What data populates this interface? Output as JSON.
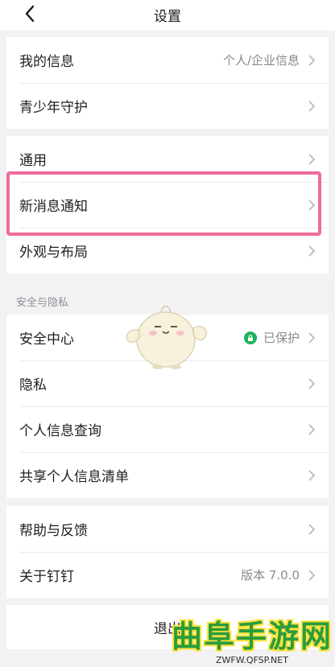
{
  "header": {
    "title": "设置",
    "back_icon": "chevron-left-icon"
  },
  "groups": [
    {
      "rows": [
        {
          "label": "我的信息",
          "value": "个人/企业信息"
        },
        {
          "label": "青少年守护",
          "value": ""
        }
      ]
    },
    {
      "rows": [
        {
          "label": "通用",
          "value": ""
        },
        {
          "label": "新消息通知",
          "value": ""
        },
        {
          "label": "外观与布局",
          "value": ""
        }
      ]
    },
    {
      "section_title": "安全与隐私",
      "rows": [
        {
          "label": "安全中心",
          "value": "已保护",
          "status_icon": "shield-check-icon"
        },
        {
          "label": "隐私",
          "value": ""
        },
        {
          "label": "个人信息查询",
          "value": ""
        },
        {
          "label": "共享个人信息清单",
          "value": ""
        }
      ]
    },
    {
      "rows": [
        {
          "label": "帮助与反馈",
          "value": ""
        },
        {
          "label": "关于钉钉",
          "value": "版本 7.0.0"
        }
      ]
    }
  ],
  "logout_label": "退出",
  "watermark": {
    "text": "曲阜手游网",
    "url": "ZWFW.QFSP.NET"
  },
  "colors": {
    "highlight": "#ee6a9c",
    "shield": "#1db35b",
    "watermark": "#2a9d3e"
  }
}
